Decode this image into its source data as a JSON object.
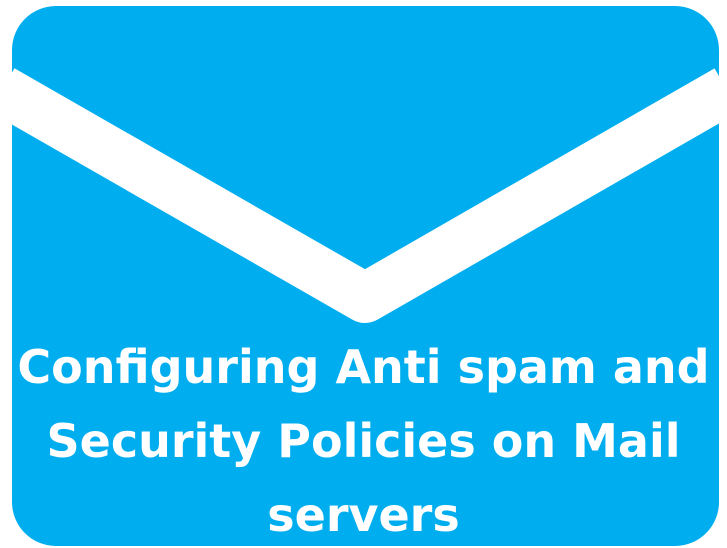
{
  "icon": "envelope-icon",
  "colors": {
    "envelope": "#00aeef",
    "flap_stroke": "#ffffff",
    "text": "#ffffff",
    "background": "#ffffff"
  },
  "title": {
    "line1": "Configuring Anti spam and",
    "line2": "Security Policies on Mail",
    "line3": "servers"
  }
}
